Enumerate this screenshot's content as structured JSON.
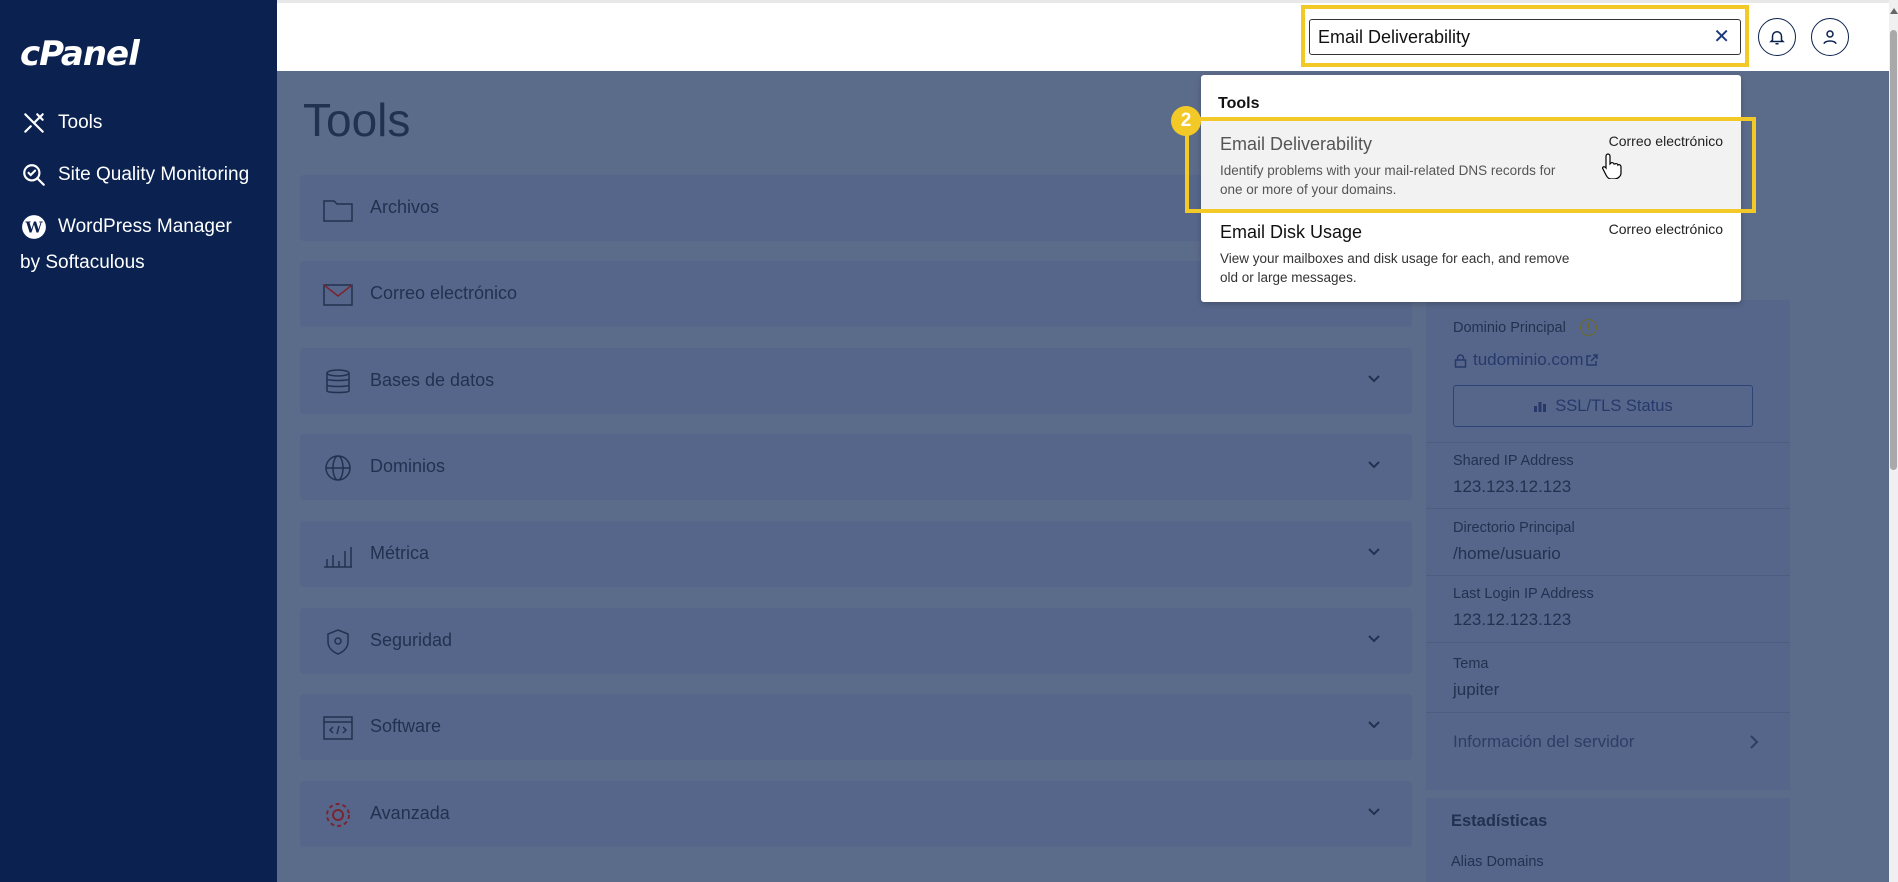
{
  "sidebar": {
    "logo": "cPanel",
    "items": [
      {
        "label": "Tools",
        "icon": "tools-icon"
      },
      {
        "label": "Site Quality Monitoring",
        "icon": "search-check-icon"
      },
      {
        "label": "WordPress Manager by Softaculous",
        "icon": "wordpress-icon"
      }
    ]
  },
  "header": {
    "search_value": "Email Deliverability",
    "clear_symbol": "✕"
  },
  "main": {
    "title": "Tools",
    "sections": [
      {
        "label": "Archivos",
        "icon": "folder-icon"
      },
      {
        "label": "Correo electrónico",
        "icon": "mail-icon"
      },
      {
        "label": "Bases de datos",
        "icon": "database-icon"
      },
      {
        "label": "Dominios",
        "icon": "globe-icon"
      },
      {
        "label": "Métrica",
        "icon": "bar-chart-icon"
      },
      {
        "label": "Seguridad",
        "icon": "shield-icon"
      },
      {
        "label": "Software",
        "icon": "code-window-icon"
      },
      {
        "label": "Avanzada",
        "icon": "gear-icon"
      }
    ]
  },
  "right_panel": {
    "main_domain_label": "Dominio Principal",
    "main_domain_value": "tudominio.com",
    "ssl_button": "SSL/TLS Status",
    "shared_ip_label": "Shared IP Address",
    "shared_ip_value": "123.123.12.123",
    "home_dir_label": "Directorio Principal",
    "home_dir_value": "/home/usuario",
    "last_login_label": "Last Login IP Address",
    "last_login_value": "123.12.123.123",
    "theme_label": "Tema",
    "theme_value": "jupiter",
    "server_info_link": "Información del servidor",
    "stats_title": "Estadísticas",
    "stats_first_item": "Alias Domains"
  },
  "dropdown": {
    "heading": "Tools",
    "step_number": "2",
    "results": [
      {
        "title": "Email Deliverability",
        "description": "Identify problems with your mail-related DNS records for one or more of your domains.",
        "category": "Correo electrónico"
      },
      {
        "title": "Email Disk Usage",
        "description": "View your mailboxes and disk usage for each, and remove old or large messages.",
        "category": "Correo electrónico"
      }
    ]
  },
  "colors": {
    "sidebar_bg": "#0b2250",
    "highlight": "#f3c928",
    "overlay_bg": "#5b6b8a"
  }
}
